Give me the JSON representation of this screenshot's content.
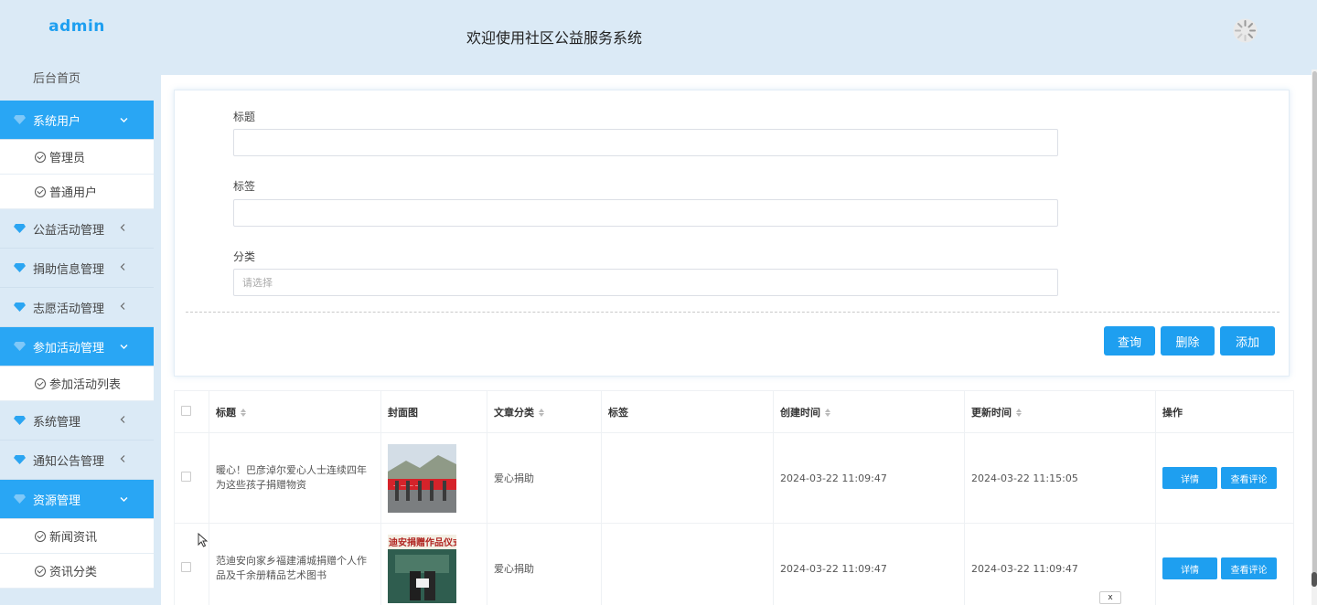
{
  "sidebar": {
    "brand": "admin",
    "home": "后台首页",
    "groups": [
      {
        "label": "系统用户",
        "active": true,
        "children": [
          "管理员",
          "普通用户"
        ]
      },
      {
        "label": "公益活动管理",
        "active": false,
        "children": []
      },
      {
        "label": "捐助信息管理",
        "active": false,
        "children": []
      },
      {
        "label": "志愿活动管理",
        "active": false,
        "children": []
      },
      {
        "label": "参加活动管理",
        "active": true,
        "children": [
          "参加活动列表"
        ]
      },
      {
        "label": "系统管理",
        "active": false,
        "children": []
      },
      {
        "label": "通知公告管理",
        "active": false,
        "children": []
      },
      {
        "label": "资源管理",
        "active": true,
        "children": [
          "新闻资讯",
          "资讯分类"
        ]
      }
    ]
  },
  "header": {
    "title": "欢迎使用社区公益服务系统"
  },
  "search": {
    "title_label": "标题",
    "tag_label": "标签",
    "category_label": "分类",
    "category_placeholder": "请选择",
    "query_button": "查询",
    "delete_button": "删除",
    "add_button": "添加"
  },
  "table": {
    "headers": {
      "title": "标题",
      "cover": "封面图",
      "category": "文章分类",
      "tags": "标签",
      "created": "创建时间",
      "updated": "更新时间",
      "ops": "操作"
    },
    "rows": [
      {
        "title": "暖心！巴彦淖尔爱心人士连续四年为这些孩子捐赠物资",
        "category": "爱心捐助",
        "tags": "",
        "created": "2024-03-22 11:09:47",
        "updated": "2024-03-22 11:15:05",
        "detail": "详情",
        "comments": "查看评论"
      },
      {
        "title": "范迪安向家乡福建浦城捐赠个人作品及千余册精品艺术图书",
        "category": "爱心捐助",
        "tags": "",
        "created": "2024-03-22 11:09:47",
        "updated": "2024-03-22 11:09:47",
        "detail": "详情",
        "comments": "查看评论",
        "cover_text": "迪安捐赠作品仪式"
      }
    ]
  },
  "misc": {
    "close_label": "x"
  },
  "colors": {
    "accent": "#1e9ff0",
    "sidebar_bg": "#dbeaf6",
    "active_bg": "#29a6f4"
  }
}
